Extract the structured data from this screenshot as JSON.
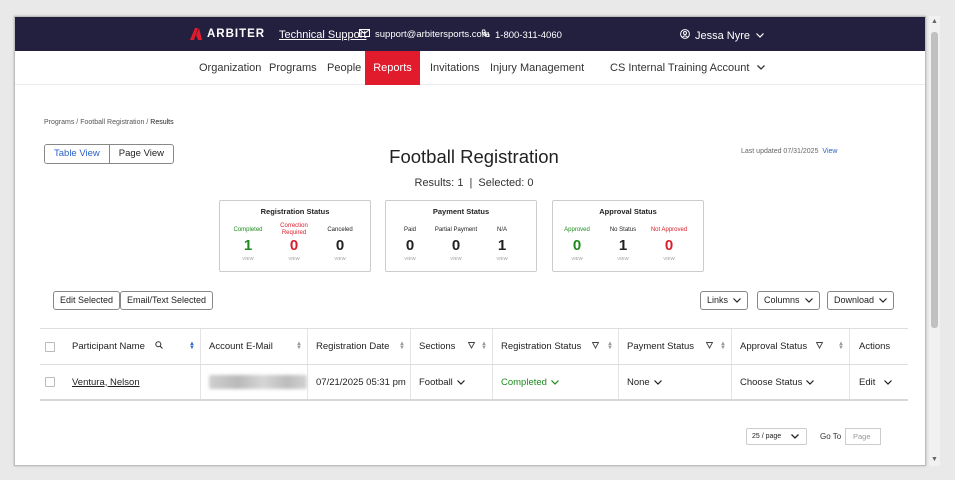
{
  "topbar": {
    "brand": "ARBITER",
    "support_link": "Technical Support",
    "email": "support@arbitersports.com",
    "phone": "1-800-311-4060",
    "user_name": "Jessa Nyre"
  },
  "nav": {
    "items": [
      "Organization",
      "Programs",
      "People",
      "Reports",
      "Invitations",
      "Injury Management"
    ],
    "active": "Reports",
    "account": "CS Internal Training Account"
  },
  "breadcrumb": {
    "items": [
      "Programs",
      "Football Registration"
    ],
    "current": "Results",
    "sep": "/"
  },
  "view_toggle": {
    "table": "Table View",
    "page": "Page View",
    "selected": "Table View"
  },
  "page": {
    "title": "Football Registration",
    "results_label": "Results:",
    "results_count": "1",
    "selected_label": "Selected:",
    "selected_count": "0",
    "last_updated": "Last updated 07/31/2025",
    "view_link": "View"
  },
  "cards": [
    {
      "title": "Registration Status",
      "stats": [
        {
          "label": "Completed",
          "value": "1",
          "color": "#1e8a1e",
          "view": "VIEW"
        },
        {
          "label": "Correction Required",
          "value": "0",
          "color": "#d71f2a",
          "view": "VIEW"
        },
        {
          "label": "Canceled",
          "value": "0",
          "color": "#222222",
          "view": "VIEW"
        }
      ]
    },
    {
      "title": "Payment Status",
      "stats": [
        {
          "label": "Paid",
          "value": "0",
          "color": "#222222",
          "view": "VIEW"
        },
        {
          "label": "Partial Payment",
          "value": "0",
          "color": "#222222",
          "view": "VIEW"
        },
        {
          "label": "N/A",
          "value": "1",
          "color": "#222222",
          "view": "VIEW"
        }
      ]
    },
    {
      "title": "Approval Status",
      "stats": [
        {
          "label": "Approved",
          "value": "0",
          "color": "#1e8a1e",
          "view": "VIEW"
        },
        {
          "label": "No Status",
          "value": "1",
          "color": "#222222",
          "view": "VIEW"
        },
        {
          "label": "Not Approved",
          "value": "0",
          "color": "#d71f2a",
          "view": "VIEW"
        }
      ]
    }
  ],
  "actions": {
    "edit_selected": "Edit Selected",
    "email_text_selected": "Email/Text Selected",
    "links": "Links",
    "columns": "Columns",
    "download": "Download"
  },
  "table": {
    "headers": [
      "Participant Name",
      "Account E-Mail",
      "Registration Date",
      "Sections",
      "Registration Status",
      "Payment Status",
      "Approval Status",
      "Actions"
    ],
    "rows": [
      {
        "participant": "Ventura, Nelson",
        "registration_date": "07/21/2025 05:31 pm",
        "section": "Football",
        "registration_status": "Completed",
        "payment_status": "None",
        "approval_status": "Choose Status",
        "action": "Edit"
      }
    ]
  },
  "pagination": {
    "per_page": "25 / page",
    "go_to": "Go To",
    "page_placeholder": "Page"
  }
}
